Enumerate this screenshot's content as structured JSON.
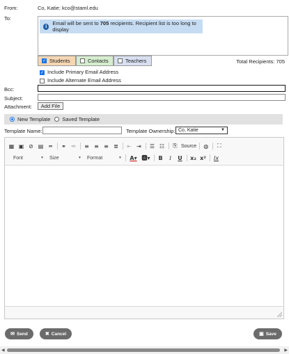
{
  "from": {
    "label": "From:",
    "value": "Co, Katie; kco@staml.edu"
  },
  "to": {
    "label": "To:",
    "notice_prefix": "Email will be sent to ",
    "notice_count": "705",
    "notice_suffix": " recipients. Recipient list is too long to display"
  },
  "tabs": [
    {
      "label": "Students",
      "checked": true,
      "color": "#f6d6b3"
    },
    {
      "label": "Contacts",
      "checked": false,
      "color": "#d5edce"
    },
    {
      "label": "Teachers",
      "checked": false,
      "color": "#d8dff0"
    }
  ],
  "total_recipients": "Total Recipients: 705",
  "options": {
    "primary": "Include Primary Email Address",
    "alternate": "Include Alternate Email Address"
  },
  "bcc": {
    "label": "Bcc:",
    "value": ""
  },
  "subject": {
    "label": "Subject:",
    "value": ""
  },
  "attachment": {
    "label": "Attachment:",
    "button": "Add File"
  },
  "template_mode": {
    "new": "New Template",
    "saved": "Saved Template",
    "selected": "new"
  },
  "template_name": {
    "label": "Template Name:",
    "value": ""
  },
  "template_ownership": {
    "label": "Template Ownership:",
    "value": "Co, Katie"
  },
  "toolbar": {
    "source_label": "Source",
    "font_label": "Font",
    "size_label": "Size",
    "format_label": "Format"
  },
  "footer": {
    "send": "Send",
    "cancel": "Cancel",
    "save": "Save"
  }
}
